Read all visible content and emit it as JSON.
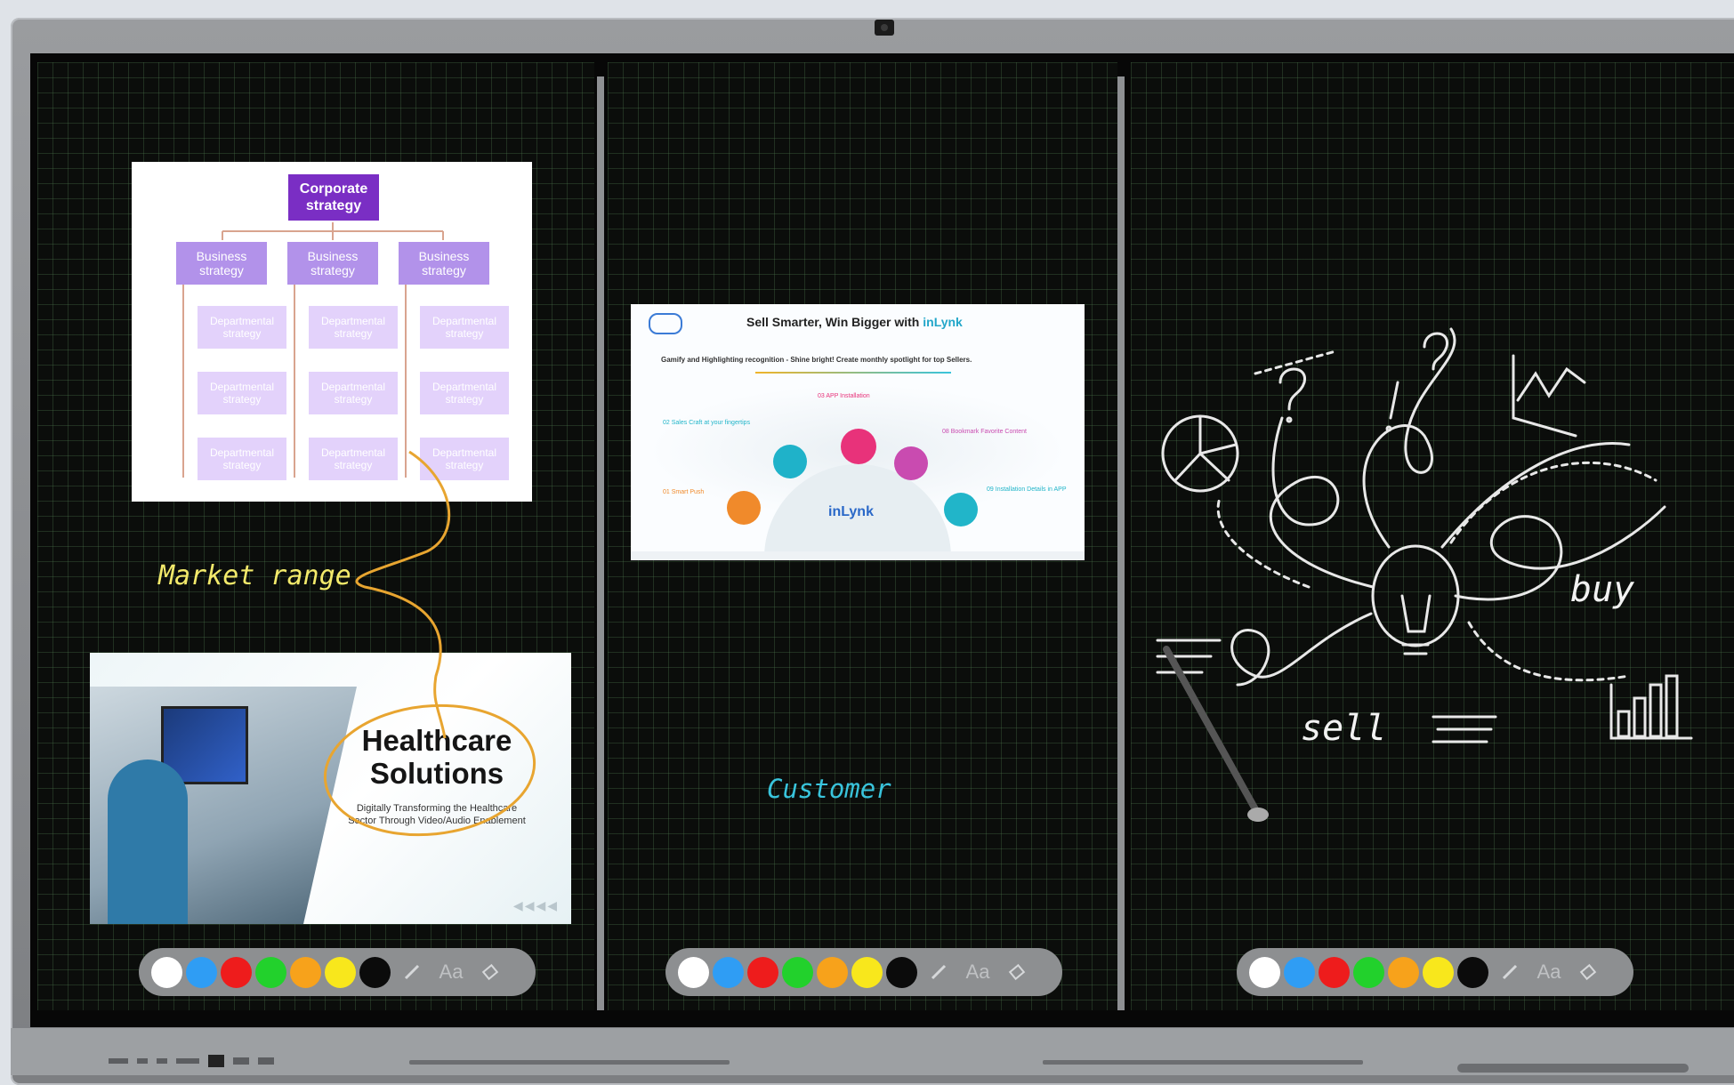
{
  "panel1": {
    "org_chart": {
      "root": "Corporate strategy",
      "business": [
        "Business strategy",
        "Business strategy",
        "Business strategy"
      ],
      "departmental": "Departmental strategy"
    },
    "annotation": "Market range",
    "slide": {
      "title_line1": "Healthcare",
      "title_line2": "Solutions",
      "subtitle_line1": "Digitally Transforming the Healthcare",
      "subtitle_line2": "Sector Through Video/Audio Enablement"
    }
  },
  "panel2": {
    "slide": {
      "title_prefix": "Sell Smarter, Win Bigger with ",
      "title_brand": "inLynk",
      "subtitle": "Gamify and Highlighting recognition - Shine bright! Create monthly spotlight for top Sellers.",
      "center_logo": "inLynk",
      "steps": [
        {
          "num": "01",
          "label": "Smart Push"
        },
        {
          "num": "02",
          "label": "Sales Craft at your fingertips"
        },
        {
          "num": "03",
          "label": "APP Installation"
        },
        {
          "num": "08",
          "label": "Bookmark Favorite Content"
        },
        {
          "num": "09",
          "label": "Installation Details in APP"
        }
      ]
    },
    "annotation": "Customer"
  },
  "panel3": {
    "words": [
      "buy",
      "sell"
    ]
  },
  "toolbar": {
    "colors": [
      "#ffffff",
      "#2f9df4",
      "#ee1c1c",
      "#22d12c",
      "#f7a21b",
      "#f8e71c",
      "#0b0b0b"
    ],
    "text_tool": "Aa"
  },
  "accent": {
    "annotation_orange": "#e8a530",
    "annotation_yellow": "#f3ea6b",
    "annotation_red": "#d42424",
    "annotation_cyan": "#39c4dc",
    "org_purple": "#7a2ec4",
    "org_lavender": "#b292ea"
  }
}
